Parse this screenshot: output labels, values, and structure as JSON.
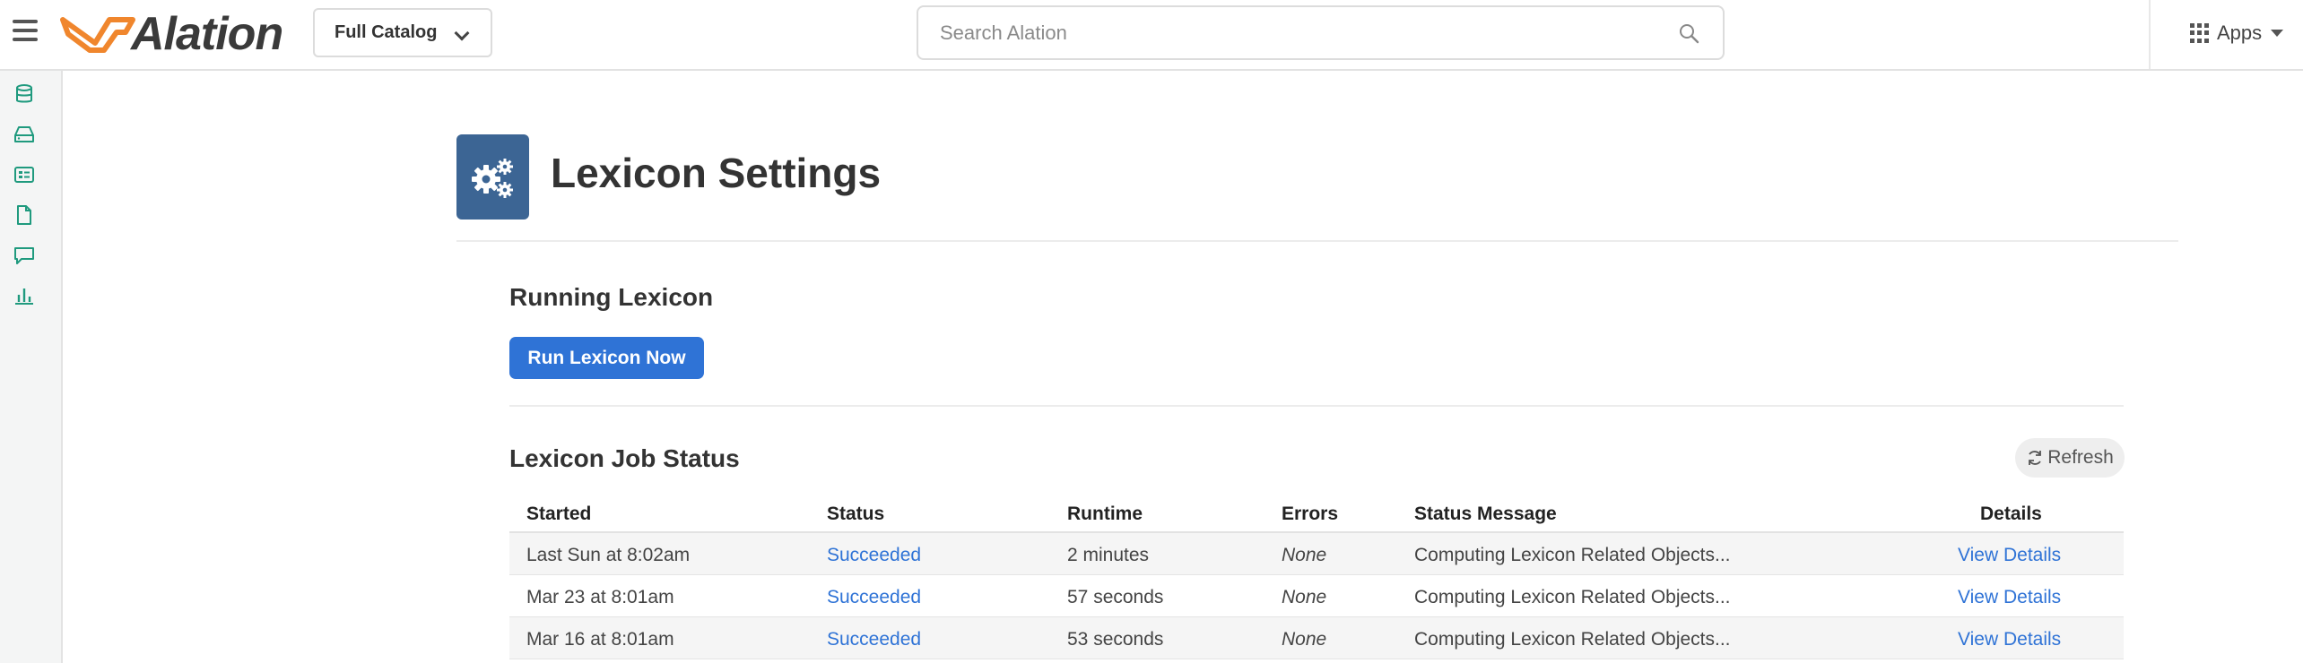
{
  "topbar": {
    "logo_text": "Alation",
    "catalog_label": "Full Catalog",
    "search_placeholder": "Search Alation",
    "apps_label": "Apps"
  },
  "rail": {
    "icons": [
      "database-icon",
      "storage-drive-icon",
      "catalog-card-icon",
      "document-icon",
      "chat-icon",
      "bar-chart-icon"
    ],
    "accent": "#1f9a7e"
  },
  "page": {
    "title": "Lexicon Settings",
    "icon": "gears-icon",
    "icon_bg": "#3c6594"
  },
  "running": {
    "heading": "Running Lexicon",
    "run_label": "Run Lexicon Now",
    "button_color": "#2f73d6"
  },
  "status": {
    "heading": "Lexicon Job Status",
    "refresh_label": "Refresh",
    "columns": {
      "started": "Started",
      "status": "Status",
      "runtime": "Runtime",
      "errors": "Errors",
      "message": "Status Message",
      "details": "Details"
    },
    "rows": [
      {
        "started": "Last Sun at 8:02am",
        "status": "Succeeded",
        "runtime": "2 minutes",
        "errors": "None",
        "message": "Computing Lexicon Related Objects...",
        "details": "View Details"
      },
      {
        "started": "Mar 23 at 8:01am",
        "status": "Succeeded",
        "runtime": "57 seconds",
        "errors": "None",
        "message": "Computing Lexicon Related Objects...",
        "details": "View Details"
      },
      {
        "started": "Mar 16 at 8:01am",
        "status": "Succeeded",
        "runtime": "53 seconds",
        "errors": "None",
        "message": "Computing Lexicon Related Objects...",
        "details": "View Details"
      }
    ]
  }
}
